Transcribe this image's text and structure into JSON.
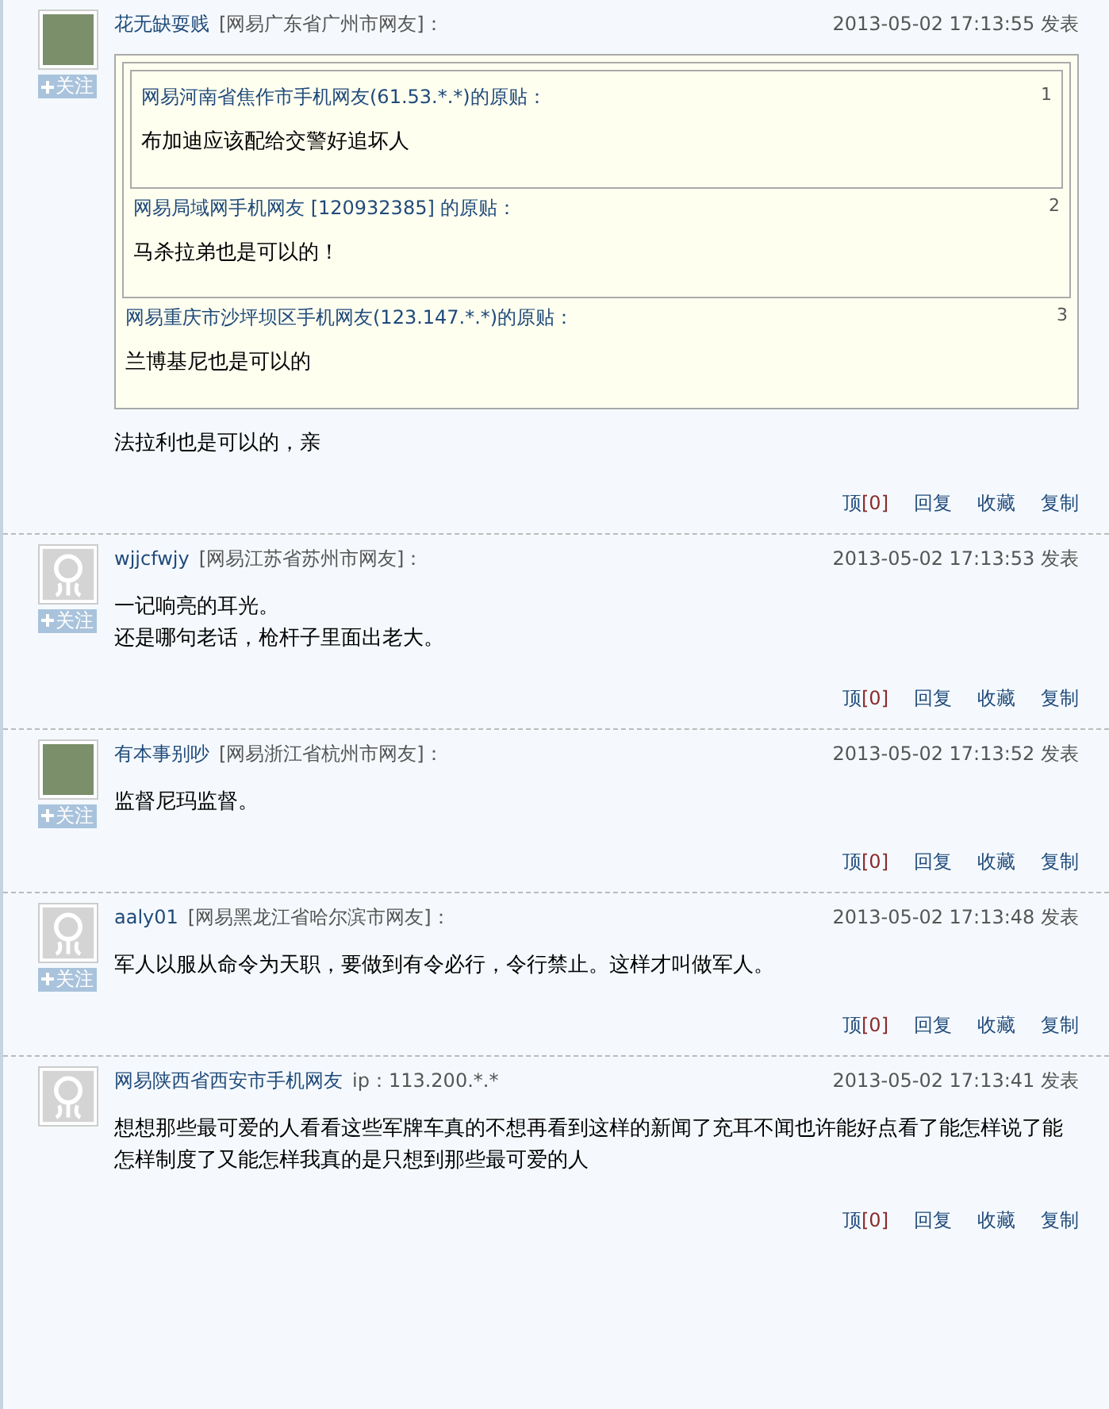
{
  "posts": [
    {
      "user": "花无缺耍贱",
      "location": "[网易广东省广州市网友]：",
      "time": "2013-05-02 17:13:55 发表",
      "avatar": {
        "kind": "photo"
      },
      "follow": "关注",
      "quote": {
        "header": "网易重庆市沙坪坝区手机网友(123.147.*.*)的原贴：",
        "number": "3",
        "body": "兰博基尼也是可以的",
        "quote": {
          "header": "网易局域网手机网友 [120932385] 的原贴：",
          "number": "2",
          "body": "马杀拉弟也是可以的！",
          "quote": {
            "header": "网易河南省焦作市手机网友(61.53.*.*)的原贴：",
            "number": "1",
            "body": "布加迪应该配给交警好追坏人"
          }
        }
      },
      "body": [
        "法拉利也是可以的，亲"
      ],
      "actions": {
        "vote_label": "顶",
        "vote_count": "[0]",
        "links": [
          "回复",
          "收藏",
          "复制"
        ]
      }
    },
    {
      "user": "wjjcfwjy",
      "location": "[网易江苏省苏州市网友]：",
      "time": "2013-05-02 17:13:53 发表",
      "avatar": {
        "kind": "default"
      },
      "follow": "关注",
      "body": [
        "一记响亮的耳光。",
        "还是哪句老话，枪杆子里面出老大。"
      ],
      "actions": {
        "vote_label": "顶",
        "vote_count": "[0]",
        "links": [
          "回复",
          "收藏",
          "复制"
        ]
      }
    },
    {
      "user": "有本事别吵",
      "location": "[网易浙江省杭州市网友]：",
      "time": "2013-05-02 17:13:52 发表",
      "avatar": {
        "kind": "photo"
      },
      "follow": "关注",
      "body": [
        "监督尼玛监督。"
      ],
      "actions": {
        "vote_label": "顶",
        "vote_count": "[0]",
        "links": [
          "回复",
          "收藏",
          "复制"
        ]
      }
    },
    {
      "user": "aaly01",
      "location": "[网易黑龙江省哈尔滨市网友]：",
      "time": "2013-05-02 17:13:48 发表",
      "avatar": {
        "kind": "default"
      },
      "follow": "关注",
      "body": [
        "军人以服从命令为天职，要做到有令必行，令行禁止。这样才叫做军人。"
      ],
      "actions": {
        "vote_label": "顶",
        "vote_count": "[0]",
        "links": [
          "回复",
          "收藏",
          "复制"
        ]
      }
    },
    {
      "user": "网易陕西省西安市手机网友",
      "location": "ip：113.200.*.*",
      "time": "2013-05-02 17:13:41 发表",
      "avatar": {
        "kind": "default"
      },
      "body": [
        "想想那些最可爱的人看看这些军牌车真的不想再看到这样的新闻了充耳不闻也许能好点看了能怎样说了能怎样制度了又能怎样我真的是只想到那些最可爱的人"
      ],
      "actions": {
        "vote_label": "顶",
        "vote_count": "[0]",
        "links": [
          "回复",
          "收藏",
          "复制"
        ]
      }
    }
  ]
}
